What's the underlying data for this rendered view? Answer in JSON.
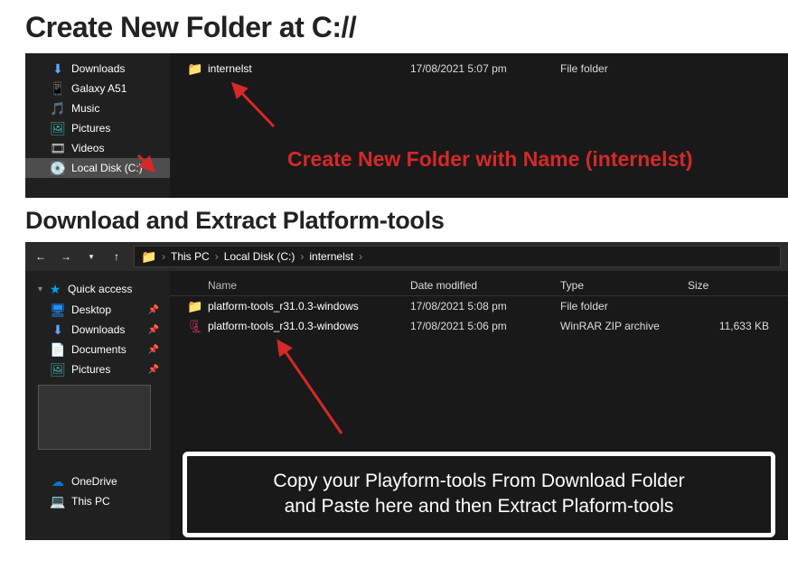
{
  "heading1": "Create New Folder at C://",
  "heading2": "Download and Extract Platform-tools",
  "annotation1": "Create New Folder with Name (internelst)",
  "overlay_line1": "Copy your Playform-tools From Download Folder",
  "overlay_line2": "and Paste here and then Extract Plaform-tools",
  "explorer1": {
    "sidebar": [
      {
        "label": "Downloads",
        "icon": "download"
      },
      {
        "label": "Galaxy A51",
        "icon": "phone"
      },
      {
        "label": "Music",
        "icon": "music"
      },
      {
        "label": "Pictures",
        "icon": "pic"
      },
      {
        "label": "Videos",
        "icon": "video"
      },
      {
        "label": "Local Disk (C:)",
        "icon": "drive",
        "selected": true
      }
    ],
    "files": [
      {
        "name": "internelst",
        "date": "17/08/2021 5:07 pm",
        "type": "File folder",
        "icon": "folder"
      }
    ]
  },
  "explorer2": {
    "breadcrumb": [
      "This PC",
      "Local Disk (C:)",
      "internelst"
    ],
    "quick_access_label": "Quick access",
    "sidebar": [
      {
        "label": "Desktop",
        "icon": "desktop",
        "pin": true
      },
      {
        "label": "Downloads",
        "icon": "download",
        "pin": true
      },
      {
        "label": "Documents",
        "icon": "doc",
        "pin": true
      },
      {
        "label": "Pictures",
        "icon": "pic",
        "pin": true
      }
    ],
    "sidebar2": [
      {
        "label": "OneDrive",
        "icon": "onedrive"
      },
      {
        "label": "This PC",
        "icon": "pc"
      }
    ],
    "columns": {
      "name": "Name",
      "date": "Date modified",
      "type": "Type",
      "size": "Size"
    },
    "files": [
      {
        "name": "platform-tools_r31.0.3-windows",
        "date": "17/08/2021 5:08 pm",
        "type": "File folder",
        "size": "",
        "icon": "folder"
      },
      {
        "name": "platform-tools_r31.0.3-windows",
        "date": "17/08/2021 5:06 pm",
        "type": "WinRAR ZIP archive",
        "size": "11,633 KB",
        "icon": "zip"
      }
    ]
  }
}
